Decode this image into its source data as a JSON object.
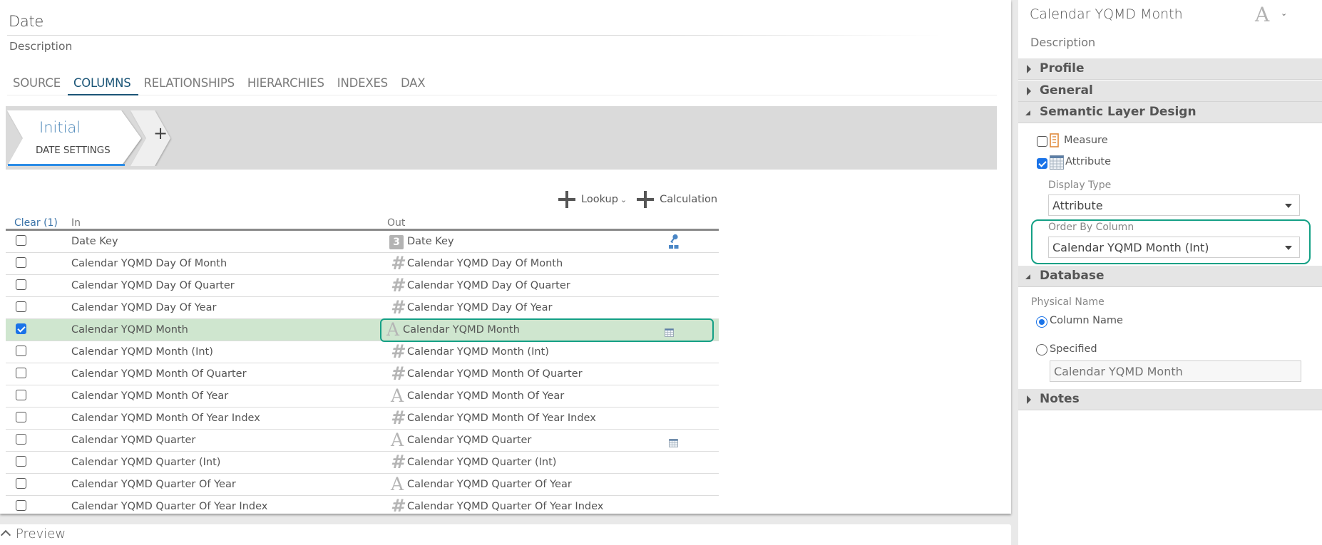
{
  "entity": {
    "title": "Date",
    "description_placeholder": "Description"
  },
  "tabs": [
    {
      "label": "SOURCE",
      "active": false
    },
    {
      "label": "COLUMNS",
      "active": true
    },
    {
      "label": "RELATIONSHIPS",
      "active": false
    },
    {
      "label": "HIERARCHIES",
      "active": false
    },
    {
      "label": "INDEXES",
      "active": false
    },
    {
      "label": "DAX",
      "active": false
    }
  ],
  "stages": {
    "current": {
      "name": "Initial",
      "subtitle": "DATE SETTINGS"
    },
    "add_label": "+"
  },
  "toolbar": {
    "lookup_label": "Lookup",
    "lookup_chevron": "⌄",
    "calculation_label": "Calculation"
  },
  "table": {
    "headers": {
      "clear": "Clear (1)",
      "in": "In",
      "out": "Out"
    },
    "rows": [
      {
        "checked": false,
        "in": "Date Key",
        "out": "Date Key",
        "type": "date",
        "type_glyph": "3",
        "flag": "key"
      },
      {
        "checked": false,
        "in": "Calendar YQMD Day Of Month",
        "out": "Calendar YQMD Day Of Month",
        "type": "hash",
        "type_glyph": "#",
        "flag": ""
      },
      {
        "checked": false,
        "in": "Calendar YQMD Day Of Quarter",
        "out": "Calendar YQMD Day Of Quarter",
        "type": "hash",
        "type_glyph": "#",
        "flag": ""
      },
      {
        "checked": false,
        "in": "Calendar YQMD Day Of Year",
        "out": "Calendar YQMD Day Of Year",
        "type": "hash",
        "type_glyph": "#",
        "flag": ""
      },
      {
        "checked": true,
        "in": "Calendar YQMD Month",
        "out": "Calendar YQMD Month",
        "type": "text",
        "type_glyph": "A",
        "flag": "attribute"
      },
      {
        "checked": false,
        "in": "Calendar YQMD Month (Int)",
        "out": "Calendar YQMD Month (Int)",
        "type": "hash",
        "type_glyph": "#",
        "flag": ""
      },
      {
        "checked": false,
        "in": "Calendar YQMD Month Of Quarter",
        "out": "Calendar YQMD Month Of Quarter",
        "type": "hash",
        "type_glyph": "#",
        "flag": ""
      },
      {
        "checked": false,
        "in": "Calendar YQMD Month Of Year",
        "out": "Calendar YQMD Month Of Year",
        "type": "text",
        "type_glyph": "A",
        "flag": ""
      },
      {
        "checked": false,
        "in": "Calendar YQMD Month Of Year Index",
        "out": "Calendar YQMD Month Of Year Index",
        "type": "hash",
        "type_glyph": "#",
        "flag": ""
      },
      {
        "checked": false,
        "in": "Calendar YQMD Quarter",
        "out": "Calendar YQMD Quarter",
        "type": "text",
        "type_glyph": "A",
        "flag": "attribute"
      },
      {
        "checked": false,
        "in": "Calendar YQMD Quarter (Int)",
        "out": "Calendar YQMD Quarter (Int)",
        "type": "hash",
        "type_glyph": "#",
        "flag": ""
      },
      {
        "checked": false,
        "in": "Calendar YQMD Quarter Of Year",
        "out": "Calendar YQMD Quarter Of Year",
        "type": "text",
        "type_glyph": "A",
        "flag": ""
      },
      {
        "checked": false,
        "in": "Calendar YQMD Quarter Of Year Index",
        "out": "Calendar YQMD Quarter Of Year Index",
        "type": "hash",
        "type_glyph": "#",
        "flag": ""
      }
    ]
  },
  "preview": {
    "label": "Preview"
  },
  "panel": {
    "title": "Calendar YQMD Month",
    "type_glyph": "A",
    "type_chevron": "⌄",
    "description_placeholder": "Description",
    "sections": {
      "profile": "Profile",
      "general": "General",
      "semantic": "Semantic Layer Design",
      "database": "Database",
      "notes": "Notes"
    },
    "semantic": {
      "measure_label": "Measure",
      "measure_checked": false,
      "attribute_label": "Attribute",
      "attribute_checked": true,
      "display_type_label": "Display Type",
      "display_type_value": "Attribute",
      "order_by_label": "Order By Column",
      "order_by_value": "Calendar YQMD Month (Int)"
    },
    "database": {
      "physical_name_label": "Physical Name",
      "option_column_name": "Column Name",
      "option_specified": "Specified",
      "selected": "column_name",
      "specified_placeholder": "Calendar YQMD Month"
    }
  },
  "colors": {
    "accent_blue": "#1a73e8",
    "tab_active": "#1b5577",
    "highlight_outline": "#14a085",
    "selected_row": "#cfe6cf",
    "stage_name": "#4a86b8"
  }
}
